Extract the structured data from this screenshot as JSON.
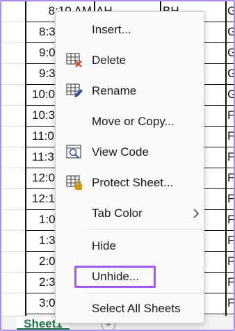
{
  "spreadsheet": {
    "time_column": [
      "8:10 AM",
      "8:3",
      "9:0",
      "9:3",
      "10:0",
      "10:3",
      "11:0",
      "11:3",
      "12:0",
      "12:1",
      "1:0",
      "1:3",
      "2:0",
      "2:3",
      "3:0"
    ],
    "col2_first": "AH",
    "col3_first": "BH",
    "col4_letters": [
      "G",
      "G",
      "G",
      "G",
      "G",
      "F",
      "F",
      "F",
      "F",
      "F",
      "F",
      "F",
      "F",
      "F",
      "F"
    ]
  },
  "tabs": {
    "sheet_name": "Sheet1",
    "add_symbol": "+"
  },
  "menu": {
    "items": [
      {
        "label": "Insert...",
        "icon": "none"
      },
      {
        "label": "Delete",
        "icon": "delete-sheet-icon"
      },
      {
        "label": "Rename",
        "icon": "rename-sheet-icon"
      },
      {
        "label": "Move or Copy...",
        "icon": "none"
      },
      {
        "label": "View Code",
        "icon": "view-code-icon"
      },
      {
        "label": "Protect Sheet...",
        "icon": "protect-sheet-icon"
      },
      {
        "label": "Tab Color",
        "icon": "none",
        "submenu": true
      },
      {
        "label": "Hide",
        "icon": "none"
      },
      {
        "label": "Unhide...",
        "icon": "none",
        "highlighted": true
      },
      {
        "label": "Select All Sheets",
        "icon": "none"
      }
    ]
  },
  "colors": {
    "highlight_border": "#a259ef",
    "sheet_tab_green": "#1e7145",
    "delete_icon_accent": "#d83b01",
    "rename_icon_accent": "#2b579a",
    "protect_icon_accent": "#d19a00"
  }
}
